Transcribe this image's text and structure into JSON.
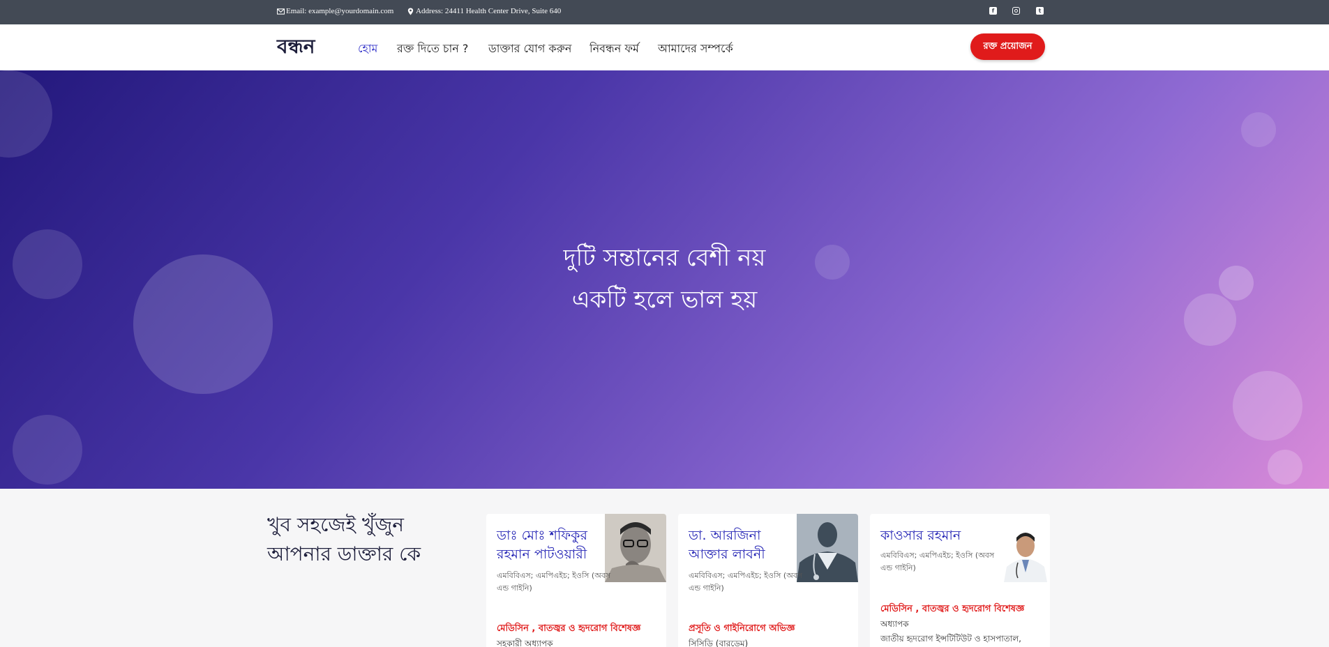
{
  "topbar": {
    "email": "Email: example@yourdomain.com",
    "address": "Address: 24411 Health Center Drive, Suite 640",
    "social": [
      "facebook-icon",
      "instagram-icon",
      "twitter-icon"
    ]
  },
  "nav": {
    "brand": "বন্ধন",
    "items": [
      "হোম",
      "রক্ত দিতে চান ?",
      "ডাক্তার যোগ করুন",
      "নিবন্ধন ফর্ম",
      "আমাদের সম্পর্কে"
    ],
    "cta": "রক্ত প্রয়োজন"
  },
  "hero": {
    "line1": "দুটি সন্তানের বেশী নয়",
    "line2": "একটি হলে ভাল হয়"
  },
  "doctors_section": {
    "title_line1": "খুব সহজেই খুঁজুন",
    "title_line2": "আপনার ডাক্তার কে",
    "cards": [
      {
        "name": "ডাঃ মোঃ শফিকুর রহমান পাটওয়ারী",
        "degree": "এমবিবিএস; এমপিএইচ; ইওসি (অবস এন্ড গাইনি)",
        "specialty": "মেডিসিন , বাতজ্বর ও হৃদরোগ বিশেষজ্ঞ",
        "role": "সহকারী অধ্যাপক"
      },
      {
        "name": "ডা. আরজিনা আক্তার লাবনী",
        "degree": "এমবিবিএস; এমপিএইচ; ইওসি (অবস এন্ড গাইনি)",
        "specialty": "প্রসূতি ও গাইনিরোগে অভিজ্ঞ",
        "role": "সিসিডি (বারডেম)"
      },
      {
        "name": "কাওসার রহমান",
        "degree": "এমবিবিএস; এমপিএইচ; ইওসি (অবস এন্ড গাইনি)",
        "specialty": "মেডিসিন , বাতজ্বর ও হৃদরোগ বিশেষজ্ঞ",
        "role": "অধ্যাপক",
        "institute": "জাতীয় হৃদরোগ ইন্সটিটিউট ও হাসপাতাল,"
      }
    ]
  },
  "colors": {
    "topbar": "#434a55",
    "accent_red": "#e01b1b",
    "link_blue": "#2e2ec8",
    "hero_start": "#23187c",
    "hero_end": "#d98ad8"
  }
}
